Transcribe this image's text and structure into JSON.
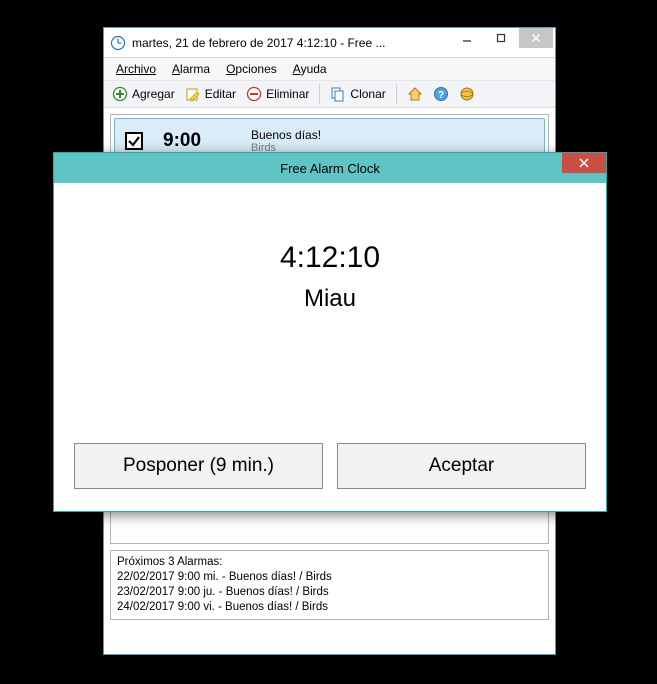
{
  "main_window": {
    "title": "martes, 21 de febrero de 2017 4:12:10  - Free ...",
    "menu": {
      "file": "Archivo",
      "alarm": "Alarma",
      "options": "Opciones",
      "help": "Ayuda"
    },
    "toolbar": {
      "add": "Agregar",
      "edit": "Editar",
      "delete": "Eliminar",
      "clone": "Clonar"
    },
    "alarm_item": {
      "time": "9:00",
      "title": "Buenos días!",
      "sound": "Birds"
    },
    "upcoming": {
      "header": "Próximos 3 Alarmas:",
      "lines": [
        "22/02/2017 9:00  mi. - Buenos días! / Birds",
        "23/02/2017 9:00  ju. - Buenos días! / Birds",
        "24/02/2017 9:00  vi. - Buenos días! / Birds"
      ]
    }
  },
  "dialog": {
    "title": "Free Alarm Clock",
    "time": "4:12:10",
    "message": "Miau",
    "snooze": "Posponer (9 min.)",
    "accept": "Aceptar"
  }
}
